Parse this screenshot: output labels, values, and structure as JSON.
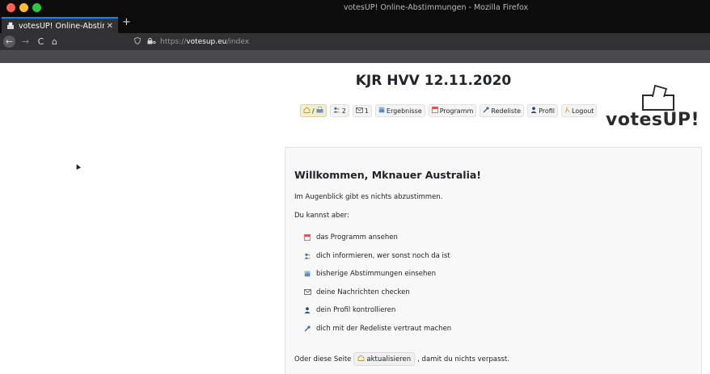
{
  "window": {
    "title": "votesUP! Online-Abstimmungen - Mozilla Firefox"
  },
  "tab": {
    "title": "votesUP! Online-Abstim",
    "favicon": "ballot-box-icon",
    "close": "✕",
    "new_tab": "+"
  },
  "nav": {
    "back": "←",
    "forward": "→",
    "reload": "C",
    "home": "⌂",
    "url_prefix": "https://",
    "url_host": "votesup.eu",
    "url_path": "/index"
  },
  "page": {
    "title": "KJR HVV 12.11.2020",
    "logo_text": "votesUP!",
    "menu": [
      {
        "name": "menu-home",
        "icon": "home-ballot-icon",
        "label": "/",
        "active": true
      },
      {
        "name": "menu-people",
        "icon": "people-icon",
        "label": "2"
      },
      {
        "name": "menu-messages",
        "icon": "envelope-icon",
        "label": "1"
      },
      {
        "name": "menu-results",
        "icon": "results-icon",
        "label": "Ergebnisse"
      },
      {
        "name": "menu-program",
        "icon": "calendar-icon",
        "label": "Programm"
      },
      {
        "name": "menu-speakers",
        "icon": "microphone-icon",
        "label": "Redeliste"
      },
      {
        "name": "menu-profile",
        "icon": "user-icon",
        "label": "Profil"
      },
      {
        "name": "menu-logout",
        "icon": "logout-icon",
        "label": "Logout"
      }
    ],
    "welcome": "Willkommen, Mknauer Australia!",
    "no_vote": "Im Augenblick gibt es nichts abzustimmen.",
    "you_can": "Du kannst aber:",
    "list": [
      {
        "icon": "calendar-icon",
        "text": "das Programm ansehen"
      },
      {
        "icon": "people-icon",
        "text": "dich informieren, wer sonst noch da ist"
      },
      {
        "icon": "results-icon",
        "text": "bisherige Abstimmungen einsehen"
      },
      {
        "icon": "envelope-icon",
        "text": "deine Nachrichten checken"
      },
      {
        "icon": "user-icon",
        "text": "dein Profil kontrollieren"
      },
      {
        "icon": "microphone-icon",
        "text": "dich mit der Redeliste vertraut machen"
      }
    ],
    "footer_before": "Oder diese Seite",
    "refresh_label": "aktualisieren",
    "footer_after": ", damit du nichts verpasst."
  },
  "colors": {
    "accent_tab": "#0a84ff",
    "chrome_dark": "#0c0c0d",
    "nav_bg": "#323234",
    "card_bg": "#f8f8f8",
    "calendar_red": "#d9534f",
    "people_blue": "#2f6fb5",
    "home_yellow": "#e0b84a"
  }
}
